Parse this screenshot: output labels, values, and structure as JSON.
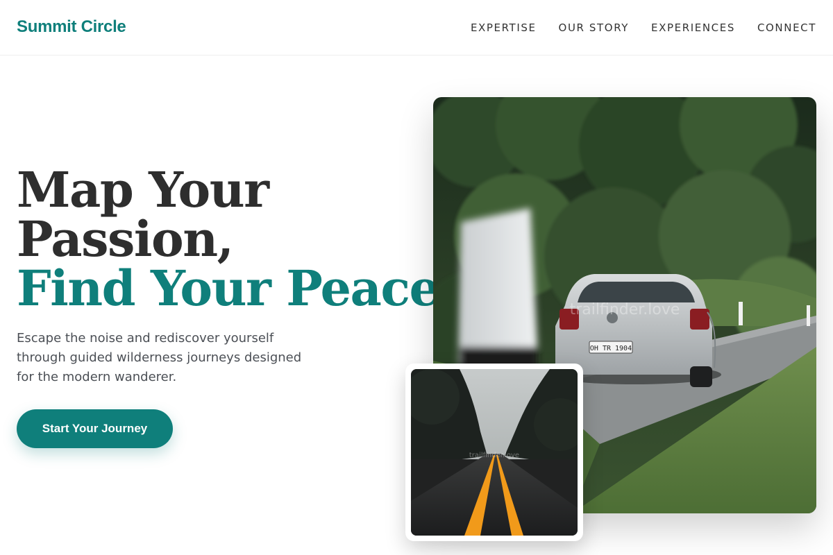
{
  "brand": {
    "name": "Summit Circle"
  },
  "nav": {
    "items": [
      "EXPERTISE",
      "OUR STORY",
      "EXPERIENCES",
      "CONNECT"
    ]
  },
  "hero": {
    "headline_line1": "Map Your",
    "headline_line2": "Passion,",
    "headline_accent": "Find Your Peace.",
    "subtext": "Escape the noise and rediscover yourself through guided wilderness journeys designed for the modern wanderer.",
    "cta_label": "Start Your Journey"
  },
  "images": {
    "main_photo": {
      "subject": "silver hatchback car driving on a forest road",
      "plate_text": "OH TR 1904",
      "watermark": "trailfinder.love"
    },
    "inset_photo": {
      "subject": "empty asphalt road with yellow center lines through dark trees",
      "watermark": "trailfinder.love"
    }
  },
  "colors": {
    "accent": "#0f7f7b",
    "text": "#2e2e2e",
    "muted": "#4b4f55",
    "background": "#ffffff"
  }
}
